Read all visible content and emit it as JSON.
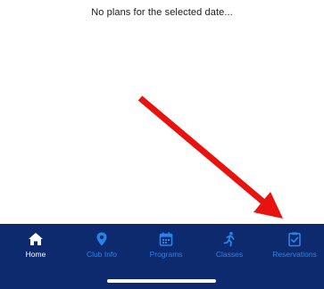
{
  "main": {
    "empty_message": "No plans for the selected date..."
  },
  "tab_bar": {
    "items": [
      {
        "label": "Home",
        "icon": "house-icon",
        "active": true
      },
      {
        "label": "Club Info",
        "icon": "map-pin-icon",
        "active": false
      },
      {
        "label": "Programs",
        "icon": "calendar-icon",
        "active": false
      },
      {
        "label": "Classes",
        "icon": "running-person-icon",
        "active": false
      },
      {
        "label": "Reservations",
        "icon": "clipboard-check-icon",
        "active": false
      }
    ]
  },
  "colors": {
    "tab_bar_background": "#0d2a6e",
    "tab_inactive": "#2a83e8",
    "tab_active": "#ffffff",
    "annotation_arrow": "#e8130f"
  }
}
